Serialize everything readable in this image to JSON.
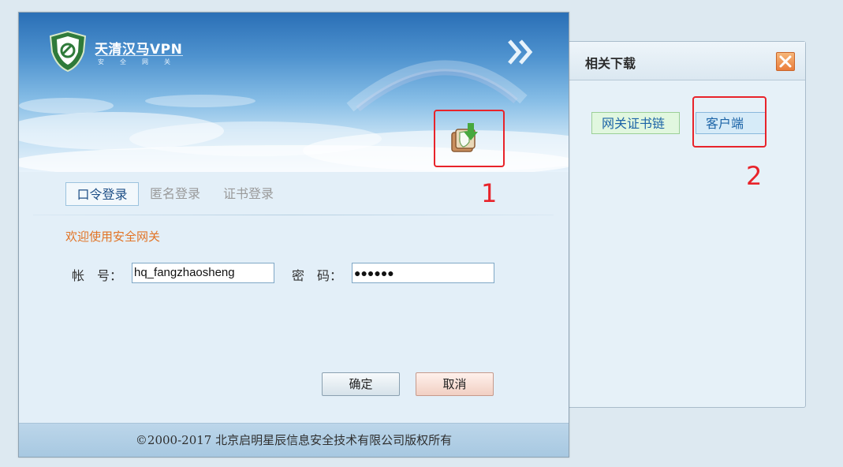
{
  "side_panel": {
    "title": "相关下载",
    "close_icon": "close-icon",
    "buttons": {
      "cert_chain": "网关证书链",
      "client": "客户端"
    }
  },
  "main": {
    "logo": {
      "name": "天清汉马VPN",
      "subtitle": "安全网关"
    },
    "download_icon": "download-icon",
    "tabs": [
      "口令登录",
      "匿名登录",
      "证书登录"
    ],
    "welcome": "欢迎使用安全网关",
    "account": {
      "label": "帐　号：",
      "value": "hq_fangzhaosheng"
    },
    "password": {
      "label": "密　码：",
      "value": "●●●●●●"
    },
    "ok_label": "确定",
    "cancel_label": "取消",
    "footer": "©2000-2017 北京启明星辰信息安全技术有限公司版权所有"
  },
  "annotations": {
    "marker_1": "1",
    "marker_2": "2"
  },
  "colors": {
    "accent": "#1d4e86",
    "welcome": "#e27426",
    "annotation_red": "#e8232a",
    "close_orange": "#ea7d3b"
  }
}
